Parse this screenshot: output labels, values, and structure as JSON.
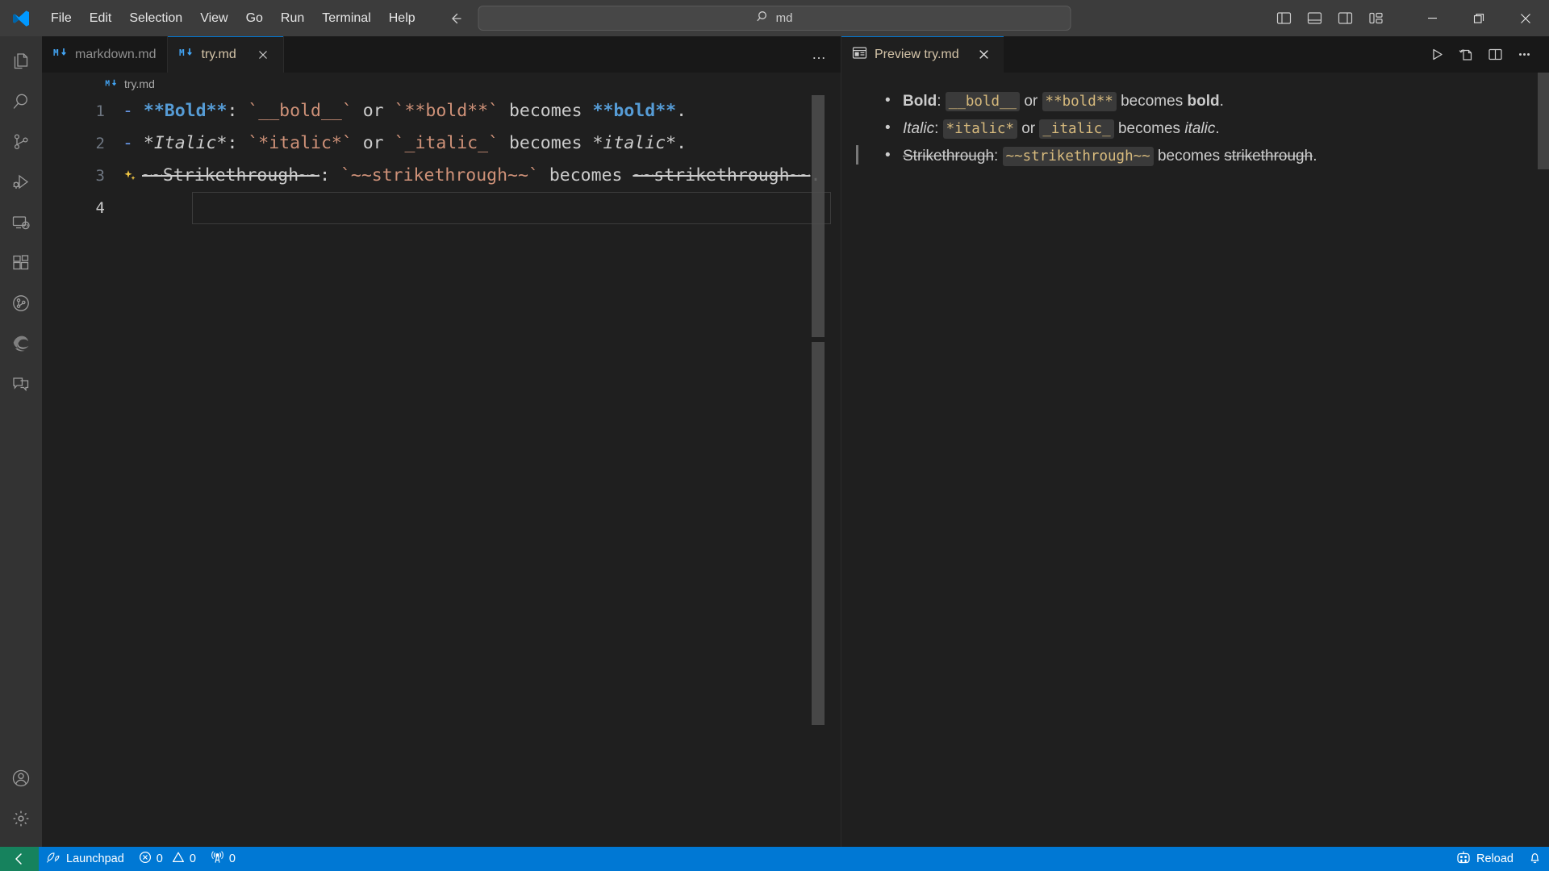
{
  "titlebar": {
    "logo_icon": "vscode-logo-icon",
    "menus": [
      "File",
      "Edit",
      "Selection",
      "View",
      "Go",
      "Run",
      "Terminal",
      "Help"
    ],
    "nav_back_icon": "arrow-left-icon",
    "nav_forward_icon": "arrow-right-icon",
    "command_center": {
      "search_icon": "search-icon",
      "value": "md",
      "placeholder": "Search"
    },
    "layout_buttons": [
      {
        "name": "toggle-primary-sidebar",
        "icon": "panel-left-icon"
      },
      {
        "name": "toggle-panel",
        "icon": "panel-bottom-icon"
      },
      {
        "name": "toggle-secondary-sidebar",
        "icon": "panel-right-icon"
      },
      {
        "name": "customize-layout",
        "icon": "layout-grid-icon"
      }
    ],
    "window_controls": [
      {
        "name": "minimize-button",
        "glyph": "─"
      },
      {
        "name": "restore-button",
        "glyph": "❐"
      },
      {
        "name": "close-button",
        "glyph": "✕"
      }
    ]
  },
  "activitybar": {
    "top_items": [
      {
        "name": "activity-explorer",
        "icon": "files-icon",
        "title": "Explorer"
      },
      {
        "name": "activity-search",
        "icon": "search-icon",
        "title": "Search"
      },
      {
        "name": "activity-source-control",
        "icon": "source-control-icon",
        "title": "Source Control"
      },
      {
        "name": "activity-run-debug",
        "icon": "run-debug-icon",
        "title": "Run and Debug"
      },
      {
        "name": "activity-remote-explorer",
        "icon": "remote-explorer-icon",
        "title": "Remote Explorer"
      },
      {
        "name": "activity-extensions",
        "icon": "extensions-icon",
        "title": "Extensions"
      },
      {
        "name": "activity-github-pr",
        "icon": "github-pull-request-icon",
        "title": "GitHub Pull Requests"
      },
      {
        "name": "activity-edge-tools",
        "icon": "edge-browser-icon",
        "title": "Microsoft Edge Tools"
      },
      {
        "name": "activity-chat",
        "icon": "chat-icon",
        "title": "Chat"
      }
    ],
    "bottom_items": [
      {
        "name": "activity-accounts",
        "icon": "account-icon",
        "title": "Accounts"
      },
      {
        "name": "activity-settings",
        "icon": "gear-icon",
        "title": "Manage"
      }
    ]
  },
  "editor": {
    "tabs": [
      {
        "name": "tab-markdown-md",
        "label": "markdown.md",
        "icon": "markdown-file-icon",
        "active": false,
        "closable": false
      },
      {
        "name": "tab-try-md",
        "label": "try.md",
        "icon": "markdown-file-icon",
        "active": true,
        "closable": true
      }
    ],
    "tabbar_more_label": "…",
    "breadcrumb": {
      "icon": "markdown-file-icon",
      "label": "try.md"
    },
    "lines": [
      {
        "number": "1",
        "has_sparkle": false,
        "segments": [
          {
            "text": "- ",
            "style": "dash"
          },
          {
            "text": "**Bold**",
            "style": "bold"
          },
          {
            "text": ": ",
            "style": "plain"
          },
          {
            "text": "`__bold__`",
            "style": "code"
          },
          {
            "text": " or ",
            "style": "plain"
          },
          {
            "text": "`**bold**`",
            "style": "code"
          },
          {
            "text": " becomes ",
            "style": "plain"
          },
          {
            "text": "**bold**",
            "style": "bold"
          },
          {
            "text": ".",
            "style": "plain"
          }
        ]
      },
      {
        "number": "2",
        "has_sparkle": false,
        "segments": [
          {
            "text": "- ",
            "style": "dash"
          },
          {
            "text": "*Italic*",
            "style": "em"
          },
          {
            "text": ": ",
            "style": "plain"
          },
          {
            "text": "`*italic*`",
            "style": "code"
          },
          {
            "text": " or ",
            "style": "plain"
          },
          {
            "text": "`_italic_`",
            "style": "code"
          },
          {
            "text": " becomes ",
            "style": "plain"
          },
          {
            "text": "*italic*",
            "style": "em"
          },
          {
            "text": ".",
            "style": "plain"
          }
        ]
      },
      {
        "number": "3",
        "has_sparkle": true,
        "sparkle_icon": "copilot-sparkle-icon",
        "segments": [
          {
            "text": "~~Strikethrough~~",
            "style": "strike"
          },
          {
            "text": ": ",
            "style": "plain"
          },
          {
            "text": "`~~strikethrough~~`",
            "style": "code"
          },
          {
            "text": " becomes ",
            "style": "plain"
          },
          {
            "text": "~~strikethrough~~",
            "style": "strike"
          },
          {
            "text": ".",
            "style": "plain"
          }
        ]
      },
      {
        "number": "4",
        "has_sparkle": false,
        "current": true,
        "segments": []
      }
    ]
  },
  "preview": {
    "tab": {
      "name": "tab-preview-try-md",
      "label": "Preview try.md",
      "icon": "preview-icon"
    },
    "actions": [
      {
        "name": "run-button",
        "icon": "play-icon"
      },
      {
        "name": "refresh-preview-button",
        "icon": "refresh-file-icon"
      },
      {
        "name": "split-editor-button",
        "icon": "split-editor-icon"
      },
      {
        "name": "more-actions-button",
        "icon": "ellipsis-icon"
      }
    ],
    "items": [
      {
        "name": "preview-bullet-bold",
        "marked": false,
        "parts": [
          {
            "text": "Bold",
            "style": "bold"
          },
          {
            "text": ": ",
            "style": "plain"
          },
          {
            "text": "__bold__",
            "style": "code"
          },
          {
            "text": " or ",
            "style": "plain"
          },
          {
            "text": "**bold**",
            "style": "code"
          },
          {
            "text": " becomes ",
            "style": "plain"
          },
          {
            "text": "bold",
            "style": "bold"
          },
          {
            "text": ".",
            "style": "plain"
          }
        ]
      },
      {
        "name": "preview-bullet-italic",
        "marked": false,
        "parts": [
          {
            "text": "Italic",
            "style": "italic"
          },
          {
            "text": ": ",
            "style": "plain"
          },
          {
            "text": "*italic*",
            "style": "code"
          },
          {
            "text": " or ",
            "style": "plain"
          },
          {
            "text": "_italic_",
            "style": "code"
          },
          {
            "text": " becomes ",
            "style": "plain"
          },
          {
            "text": "italic",
            "style": "italic"
          },
          {
            "text": ".",
            "style": "plain"
          }
        ]
      },
      {
        "name": "preview-bullet-strikethrough",
        "marked": true,
        "parts": [
          {
            "text": "Strikethrough",
            "style": "strike"
          },
          {
            "text": ": ",
            "style": "plain"
          },
          {
            "text": "~~strikethrough~~",
            "style": "code"
          },
          {
            "text": " becomes ",
            "style": "plain"
          },
          {
            "text": "strikethrough",
            "style": "strike"
          },
          {
            "text": ".",
            "style": "plain"
          }
        ]
      }
    ]
  },
  "statusbar": {
    "remote_icon": "remote-indicator-icon",
    "left_items": [
      {
        "name": "status-launchpad",
        "icon": "rocket-icon",
        "label": "Launchpad"
      },
      {
        "name": "status-problems",
        "icon": "error-warning-icon",
        "label": "0",
        "label2": "0"
      },
      {
        "name": "status-ports",
        "icon": "radio-tower-icon",
        "label": "0"
      }
    ],
    "right_items": [
      {
        "name": "status-live-preview",
        "icon": "live-preview-icon",
        "label": "Reload"
      },
      {
        "name": "status-notifications",
        "icon": "bell-icon",
        "label": ""
      }
    ]
  },
  "colors": {
    "accent": "#0078d4",
    "titlebar_bg": "#3c3c3c",
    "editor_bg": "#1f1f1f",
    "tabbar_bg": "#181818",
    "activitybar_bg": "#333333",
    "remote_green": "#16825d",
    "bold_blue": "#569cd6",
    "code_orange": "#ce9178",
    "preview_code": "#d7ba7d"
  }
}
